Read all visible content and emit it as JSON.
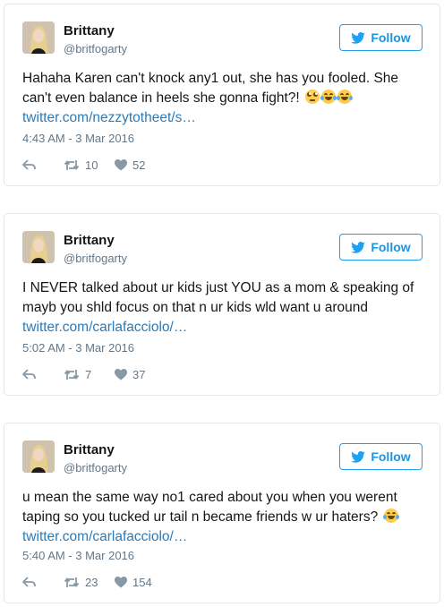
{
  "tweets": [
    {
      "name": "Brittany",
      "handle": "@britfogarty",
      "follow_label": "Follow",
      "text": "Hahaha Karen can't knock any1 out, she has you fooled. She can't even balance in heels she gonna fight?!",
      "emojis": [
        "face-with-rolling-eyes",
        "face-with-tears-of-joy",
        "face-with-tears-of-joy"
      ],
      "link": "twitter.com/nezzytotheet/s…",
      "timestamp": "4:43 AM - 3 Mar 2016",
      "retweets": "10",
      "likes": "52"
    },
    {
      "name": "Brittany",
      "handle": "@britfogarty",
      "follow_label": "Follow",
      "text": "I NEVER talked about ur kids just YOU as a mom & speaking of mayb you shld focus on that n ur kids wld want u around",
      "emojis": [],
      "link": "twitter.com/carlafacciolo/…",
      "timestamp": "5:02 AM - 3 Mar 2016",
      "retweets": "7",
      "likes": "37"
    },
    {
      "name": "Brittany",
      "handle": "@britfogarty",
      "follow_label": "Follow",
      "text": "u mean the same way no1 cared about you when you werent taping so you tucked ur tail n became friends w ur haters?",
      "emojis": [
        "face-with-tears-of-joy"
      ],
      "link": "twitter.com/carlafacciolo/…",
      "timestamp": "5:40 AM - 3 Mar 2016",
      "retweets": "23",
      "likes": "154"
    }
  ],
  "colors": {
    "accent": "#1da1f2",
    "link": "#2b7bb9",
    "muted": "#657786",
    "border": "#e1e8ed"
  }
}
